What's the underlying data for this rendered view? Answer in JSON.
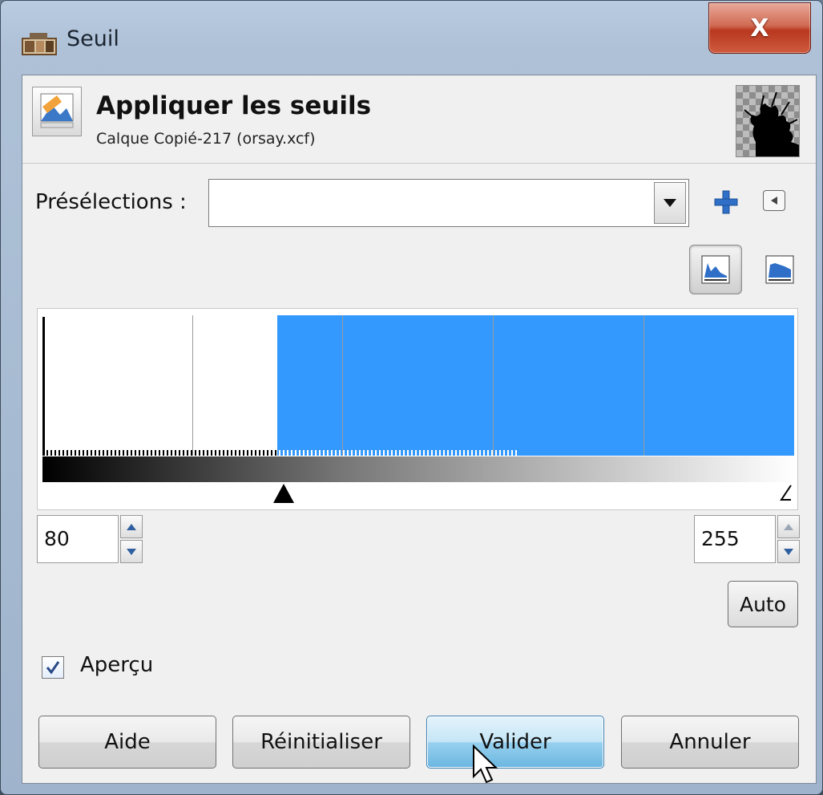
{
  "window": {
    "title": "Seuil",
    "close_label": "X"
  },
  "header": {
    "title": "Appliquer les seuils",
    "subtitle": "Calque Copié-217 (orsay.xcf)"
  },
  "presets": {
    "label": "Présélections :",
    "value": ""
  },
  "histogram": {
    "low_value": "80",
    "high_value": "255",
    "low_fraction": 0.3137,
    "high_fraction": 1.0,
    "selection_color": "#3399ff"
  },
  "buttons": {
    "auto": "Auto",
    "help": "Aide",
    "reset": "Réinitialiser",
    "ok": "Valider",
    "cancel": "Annuler"
  },
  "preview": {
    "label": "Aperçu",
    "checked": true
  },
  "icons": {
    "window": "image-icon",
    "header": "threshold-tool-icon",
    "add_preset": "plus-icon",
    "preset_menu": "left-triangle-icon",
    "linear_mode": "linear-histogram-icon",
    "log_mode": "log-histogram-icon"
  }
}
